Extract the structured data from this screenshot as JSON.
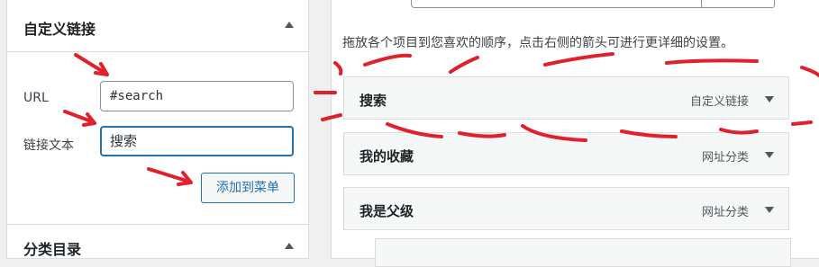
{
  "left_panel": {
    "title": "自定义链接",
    "url_label": "URL",
    "url_value": "#search",
    "link_text_label": "链接文本",
    "link_text_value": "搜索",
    "add_button_label": "添加到菜单",
    "next_panel_title": "分类目录"
  },
  "right_panel": {
    "instructions": "拖放各个项目到您喜欢的顺序，点击右侧的箭头可进行更详细的设置。",
    "menu_items": [
      {
        "title": "搜索",
        "type": "自定义链接"
      },
      {
        "title": "我的收藏",
        "type": "网址分类"
      },
      {
        "title": "我是父级",
        "type": "网址分类"
      }
    ]
  },
  "annotation_color": "#e0202a",
  "icons": {
    "collapse": "caret-up-icon",
    "expand": "caret-down-icon",
    "arrow": "red-arrow-annotation-icon"
  }
}
